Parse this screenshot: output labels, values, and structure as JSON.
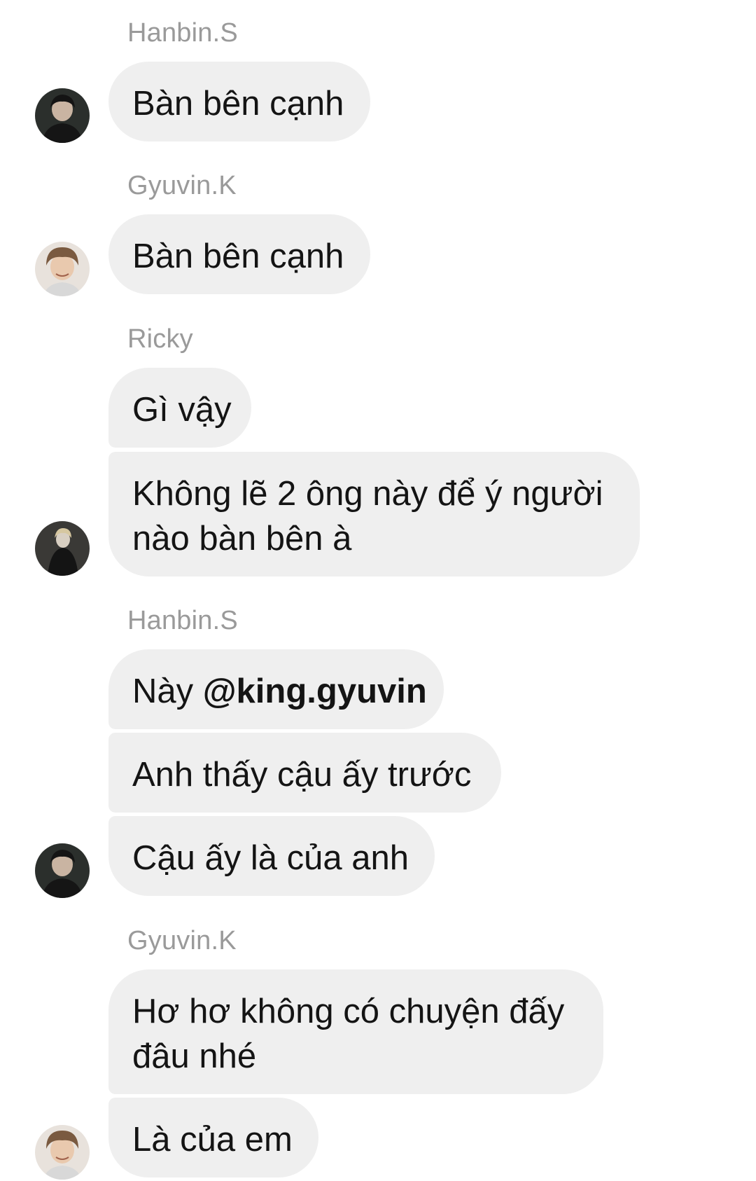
{
  "conversation": [
    {
      "sender": "Hanbin.S",
      "avatar_icon": "hanbin-avatar",
      "messages": [
        "Bàn bên cạnh"
      ]
    },
    {
      "sender": "Gyuvin.K",
      "avatar_icon": "gyuvin-avatar",
      "messages": [
        "Bàn bên cạnh"
      ]
    },
    {
      "sender": "Ricky",
      "avatar_icon": "ricky-avatar",
      "messages": [
        "Gì vậy",
        "Không lẽ 2 ông này để ý người nào bàn bên à"
      ]
    },
    {
      "sender": "Hanbin.S",
      "avatar_icon": "hanbin-avatar",
      "messages": [
        {
          "prefix": "Này ",
          "mention": "@king.gyuvin"
        },
        "Anh thấy cậu ấy trước",
        "Cậu ấy là của anh"
      ]
    },
    {
      "sender": "Gyuvin.K",
      "avatar_icon": "gyuvin-avatar",
      "messages": [
        "Hơ hơ không có chuyện đấy đâu nhé",
        "Là của em"
      ]
    }
  ],
  "colors": {
    "bubble_background": "#efefef",
    "sender_name": "#9a9a9a",
    "message_text": "#141414",
    "page_background": "#ffffff"
  }
}
